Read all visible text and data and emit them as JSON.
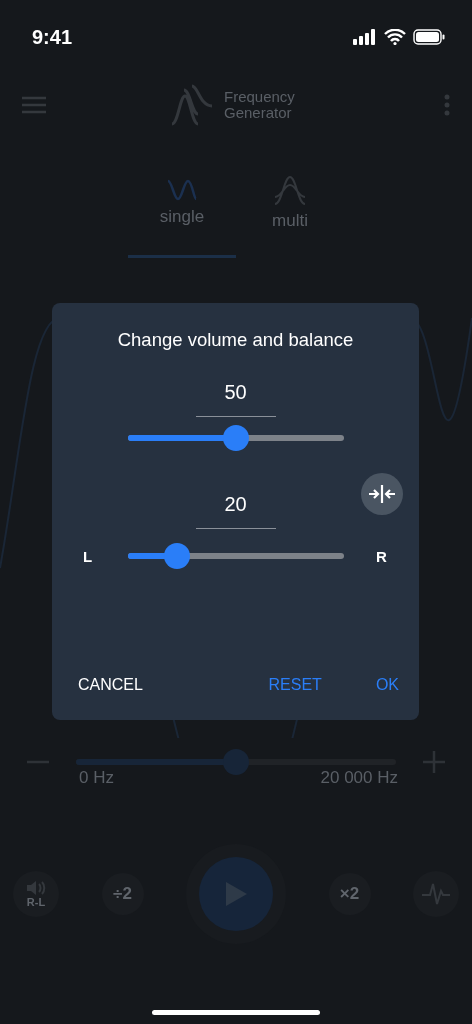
{
  "status_bar": {
    "time": "9:41"
  },
  "header": {
    "title": "Frequency Generator"
  },
  "tabs": [
    {
      "label": "single",
      "kind": "single",
      "selected": true
    },
    {
      "label": "multi",
      "kind": "multi",
      "selected": false
    }
  ],
  "dialog": {
    "title": "Change volume and balance",
    "volume": {
      "value": "50",
      "level": 0.5
    },
    "balance": {
      "value": "20",
      "level": 0.23,
      "left_label": "L",
      "right_label": "R"
    },
    "buttons": [
      {
        "label": "CANCEL",
        "kind": "neutral"
      },
      {
        "label": "RESET",
        "kind": "accent"
      },
      {
        "label": "OK",
        "kind": "accent"
      }
    ]
  },
  "frequency": {
    "level": 0.5,
    "min_label": "0 Hz",
    "max_label": "20 000 Hz"
  },
  "controls": [
    {
      "kind": "speaker",
      "text": "R-L"
    },
    {
      "kind": "divide",
      "text": "÷2"
    },
    {
      "kind": "play"
    },
    {
      "kind": "multiply",
      "text": "×2"
    },
    {
      "kind": "pulse"
    }
  ]
}
